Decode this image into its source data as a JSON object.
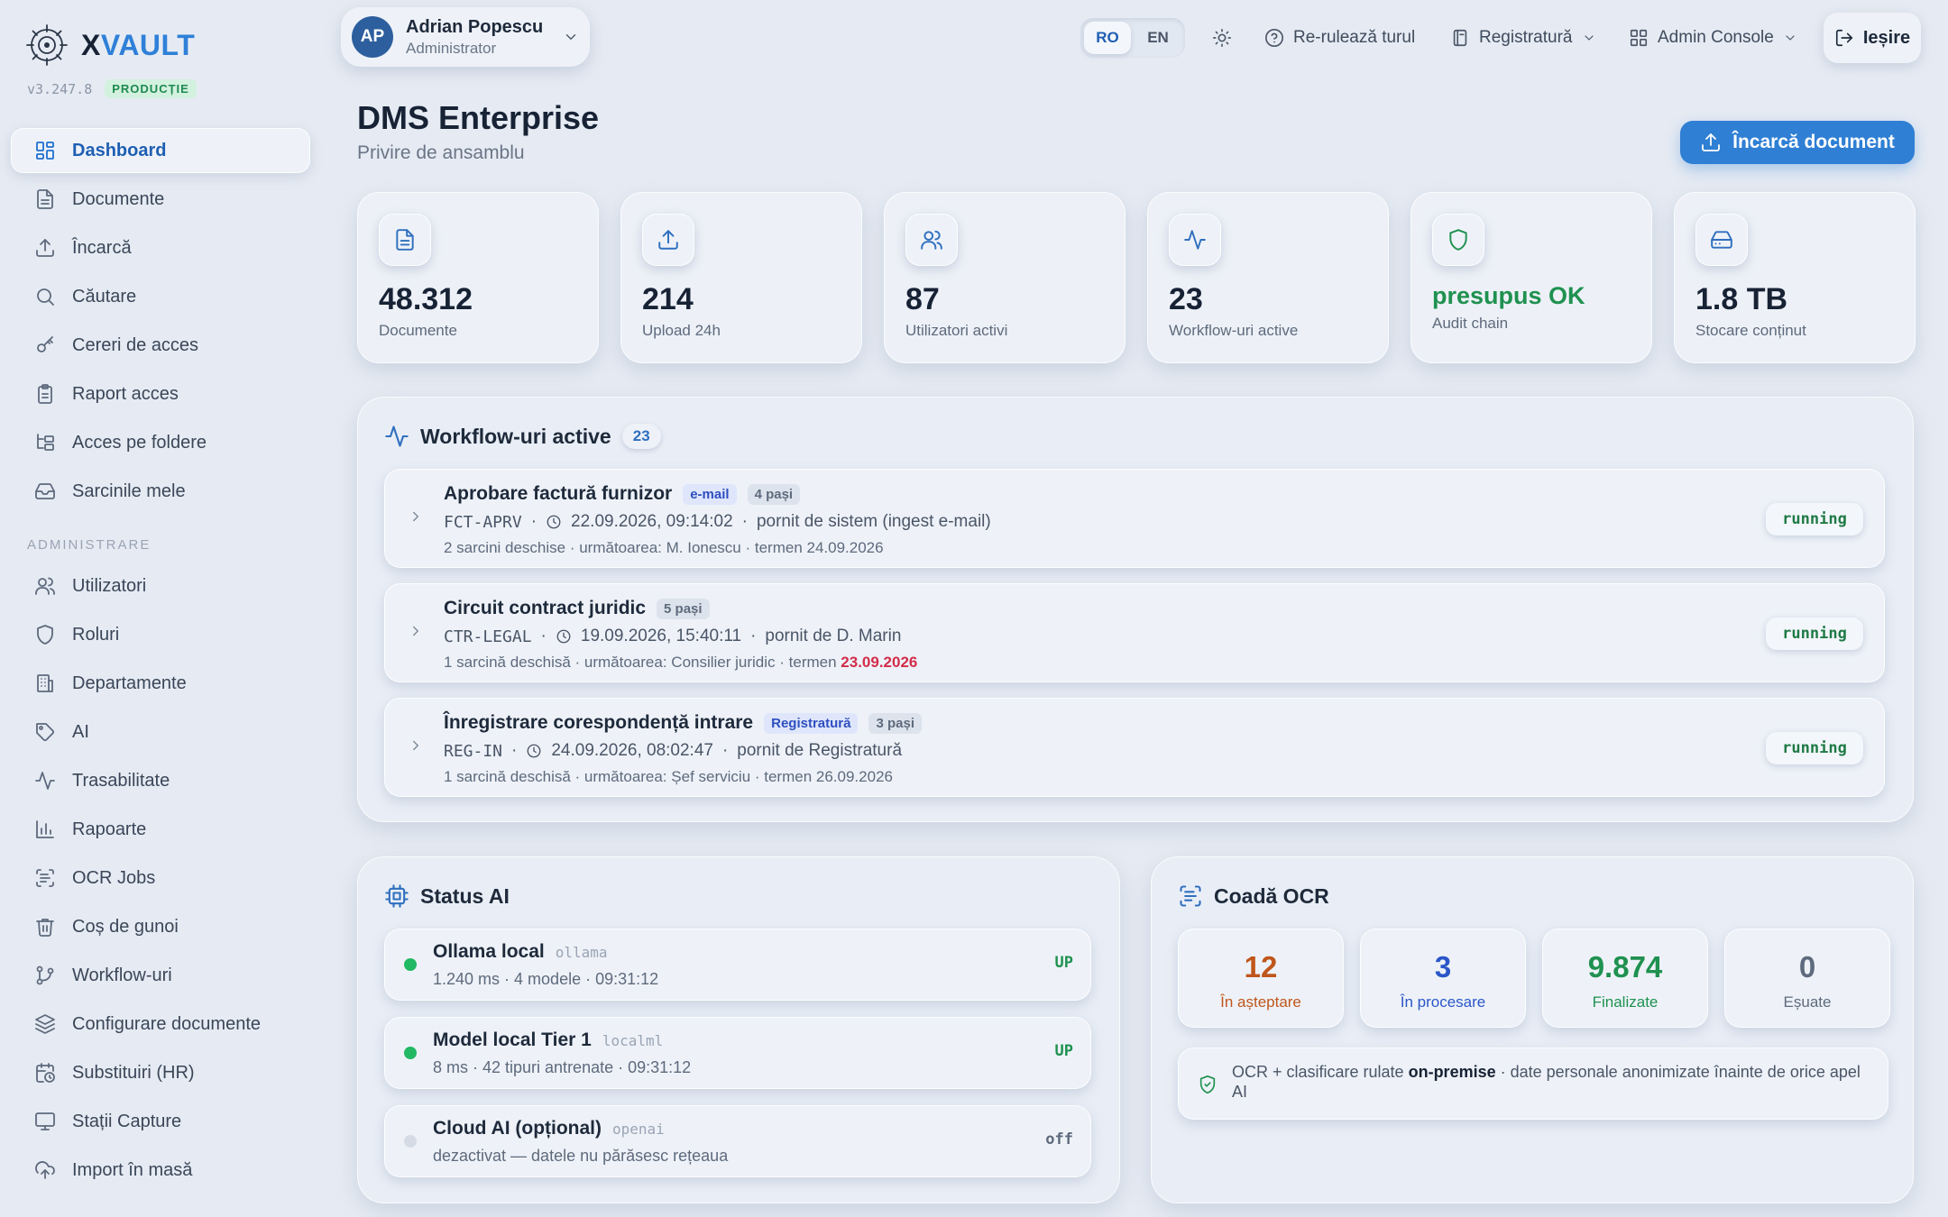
{
  "brand": {
    "name_x": "X",
    "name_rest": "VAULT",
    "version": "v3.247.8",
    "env": "PRODUCȚIE"
  },
  "sidebar": {
    "items": [
      {
        "label": "Dashboard",
        "icon": "dashboard-icon",
        "active": true
      },
      {
        "label": "Documente",
        "icon": "document-icon"
      },
      {
        "label": "Încarcă",
        "icon": "upload-icon"
      },
      {
        "label": "Căutare",
        "icon": "search-icon"
      },
      {
        "label": "Cereri de acces",
        "icon": "key-icon"
      },
      {
        "label": "Raport acces",
        "icon": "clipboard-icon"
      },
      {
        "label": "Acces pe foldere",
        "icon": "folder-tree-icon"
      },
      {
        "label": "Sarcinile mele",
        "icon": "inbox-icon"
      }
    ],
    "admin_section": "ADMINISTRARE",
    "admin_items": [
      {
        "label": "Utilizatori",
        "icon": "users-icon"
      },
      {
        "label": "Roluri",
        "icon": "shield-icon"
      },
      {
        "label": "Departamente",
        "icon": "building-icon"
      },
      {
        "label": "AI",
        "icon": "tag-icon"
      },
      {
        "label": "Trasabilitate",
        "icon": "activity-icon"
      },
      {
        "label": "Rapoarte",
        "icon": "bar-chart-icon"
      },
      {
        "label": "OCR Jobs",
        "icon": "scan-text-icon"
      },
      {
        "label": "Coș de gunoi",
        "icon": "trash-icon"
      },
      {
        "label": "Workflow-uri",
        "icon": "git-branch-icon"
      },
      {
        "label": "Configurare documente",
        "icon": "layers-icon"
      },
      {
        "label": "Substituiri (HR)",
        "icon": "calendar-clock-icon"
      },
      {
        "label": "Stații Capture",
        "icon": "monitor-icon"
      },
      {
        "label": "Import în masă",
        "icon": "cloud-upload-icon"
      }
    ]
  },
  "header": {
    "user": {
      "initials": "AP",
      "name": "Adrian Popescu",
      "role": "Administrator"
    },
    "lang": {
      "ro": "RO",
      "en": "EN",
      "active": "RO"
    },
    "actions": {
      "tour": "Re-rulează turul",
      "registratura": "Registratură",
      "admin": "Admin Console",
      "logout": "Ieșire"
    }
  },
  "page": {
    "title": "DMS Enterprise",
    "subtitle": "Privire de ansamblu",
    "upload_label": "Încarcă document"
  },
  "stats": [
    {
      "value": "48.312",
      "label": "Documente",
      "icon": "document-icon"
    },
    {
      "value": "214",
      "label": "Upload 24h",
      "icon": "upload-icon"
    },
    {
      "value": "87",
      "label": "Utilizatori activi",
      "icon": "users-icon"
    },
    {
      "value": "23",
      "label": "Workflow-uri active",
      "icon": "activity-icon"
    },
    {
      "value": "presupus OK",
      "label": "Audit chain",
      "icon": "shield-icon"
    },
    {
      "value": "1.8 TB",
      "label": "Stocare conținut",
      "icon": "hard-drive-icon"
    }
  ],
  "workflows": {
    "title": "Workflow-uri active",
    "count": "23",
    "items": [
      {
        "title": "Aprobare factură furnizor",
        "source": "e-mail",
        "steps": "4 pași",
        "code": "FCT-APRV",
        "time": "22.09.2026, 09:14:02",
        "started": "pornit de sistem (ingest e-mail)",
        "sub": "2 sarcini deschise · următoarea: M. Ionescu · termen 24.09.2026",
        "due": "",
        "status": "running"
      },
      {
        "title": "Circuit contract juridic",
        "source": "",
        "steps": "5 pași",
        "code": "CTR-LEGAL",
        "time": "19.09.2026, 15:40:11",
        "started": "pornit de D. Marin",
        "sub": "1 sarcină deschisă · următoarea: Consilier juridic · termen ",
        "due": "23.09.2026",
        "status": "running"
      },
      {
        "title": "Înregistrare corespondență intrare",
        "source": "Registratură",
        "steps": "3 pași",
        "code": "REG-IN",
        "time": "24.09.2026, 08:02:47",
        "started": "pornit de Registratură",
        "sub": "1 sarcină deschisă · următoarea: Șef serviciu · termen 26.09.2026",
        "due": "",
        "status": "running"
      }
    ]
  },
  "ai_status": {
    "title": "Status AI",
    "items": [
      {
        "name": "Ollama local",
        "provider": "ollama",
        "sub": "1.240 ms · 4 modele · 09:31:12",
        "status": "UP",
        "color": "#22b864"
      },
      {
        "name": "Model local Tier 1",
        "provider": "localml",
        "sub": "8 ms · 42 tipuri antrenate · 09:31:12",
        "status": "UP",
        "color": "#22b864"
      },
      {
        "name": "Cloud AI (opțional)",
        "provider": "openai",
        "sub": "dezactivat — datele nu părăsesc rețeaua",
        "status": "off",
        "color": "#d5dbe4"
      }
    ]
  },
  "ocr": {
    "title": "Coadă OCR",
    "boxes": [
      {
        "value": "12",
        "label": "În așteptare",
        "color": "#c0561c"
      },
      {
        "value": "3",
        "label": "În procesare",
        "color": "#2a56c8"
      },
      {
        "value": "9.874",
        "label": "Finalizate",
        "color": "#1f9150"
      },
      {
        "value": "0",
        "label": "Eșuate",
        "color": "#5e6a7d"
      }
    ],
    "note_pre": "OCR + clasificare rulate ",
    "note_bold": "on-premise",
    "note_post": " · date personale anonimizate înainte de orice apel AI"
  }
}
